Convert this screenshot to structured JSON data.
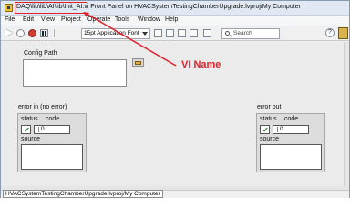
{
  "window": {
    "title": "DAQ\\lib\\lib\\AI\\lib\\Init_AI.vi Front Panel on HVACSystemTestingChamberUpgrade.lvproj/My Computer"
  },
  "menubar": {
    "items": [
      "File",
      "Edit",
      "View",
      "Project",
      "Operate",
      "Tools",
      "Window",
      "Help"
    ]
  },
  "toolbar": {
    "font_value": "15pt Application Font",
    "search_placeholder": "Search",
    "help_label": "?"
  },
  "front_panel": {
    "config_path_label": "Config Path",
    "error_in": {
      "label": "error in (no error)",
      "status_label": "status",
      "code_label": "code",
      "code_value": "0",
      "source_label": "source"
    },
    "error_out": {
      "label": "error out",
      "status_label": "status",
      "code_label": "code",
      "code_value": "0",
      "source_label": "source"
    }
  },
  "statusbar": {
    "text": "HVACSystemTestingChamberUpgrade.lvproj/My Computer"
  },
  "annotation": {
    "text": "VI Name",
    "color": "#e0202a"
  },
  "icons": {
    "app": "labview-vi-icon",
    "check": "green-check-icon",
    "folder": "folder-icon"
  }
}
